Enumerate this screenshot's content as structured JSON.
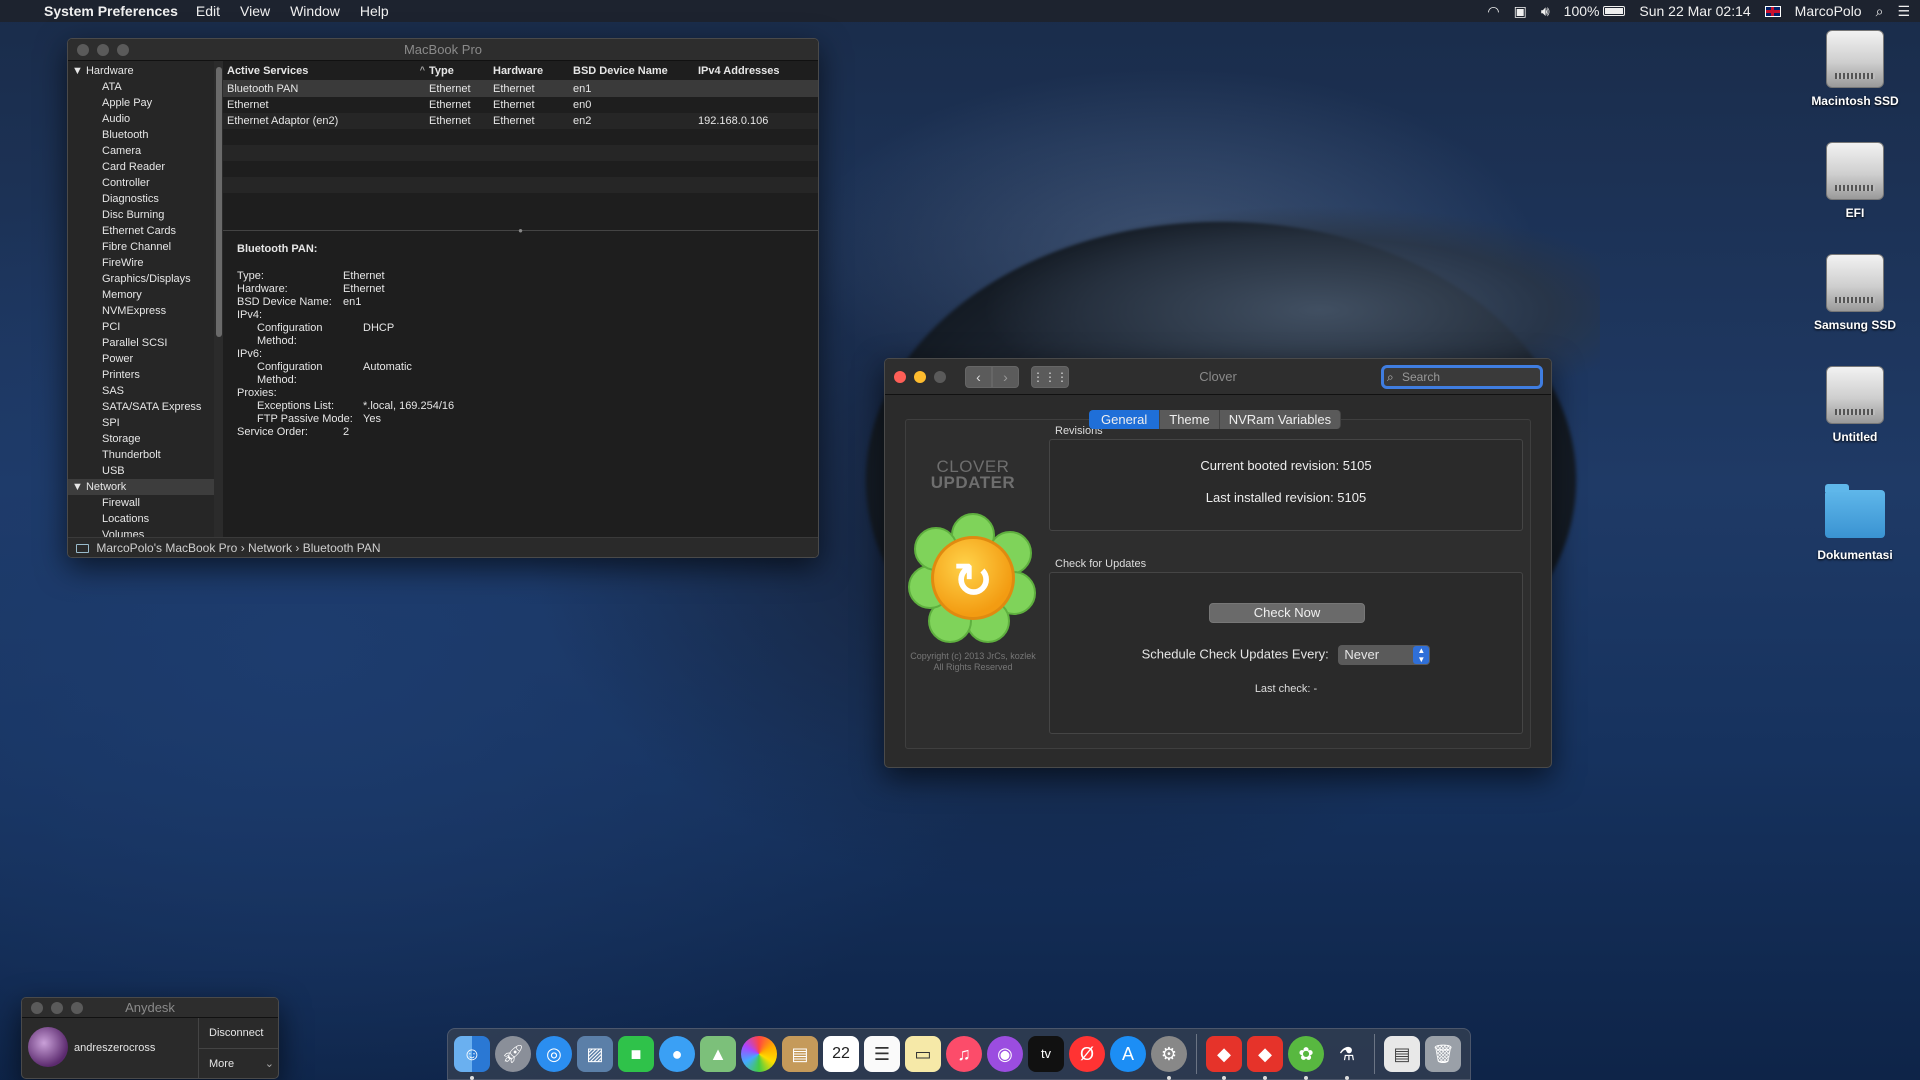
{
  "menubar": {
    "app_name": "System Preferences",
    "menus": [
      "Edit",
      "View",
      "Window",
      "Help"
    ],
    "battery": "100%",
    "datetime": "Sun 22 Mar  02:14",
    "user": "MarcoPolo"
  },
  "desktop_icons": [
    {
      "label": "Macintosh SSD",
      "icon": "drive-icon"
    },
    {
      "label": "EFI",
      "icon": "drive-icon"
    },
    {
      "label": "Samsung SSD",
      "icon": "drive-icon"
    },
    {
      "label": "Untitled",
      "icon": "drive-icon"
    },
    {
      "label": "Dokumentasi",
      "icon": "folder-icon"
    }
  ],
  "sysinfo": {
    "title": "MacBook Pro",
    "sidebar": {
      "hardware_label": "Hardware",
      "hardware_items": [
        "ATA",
        "Apple Pay",
        "Audio",
        "Bluetooth",
        "Camera",
        "Card Reader",
        "Controller",
        "Diagnostics",
        "Disc Burning",
        "Ethernet Cards",
        "Fibre Channel",
        "FireWire",
        "Graphics/Displays",
        "Memory",
        "NVMExpress",
        "PCI",
        "Parallel SCSI",
        "Power",
        "Printers",
        "SAS",
        "SATA/SATA Express",
        "SPI",
        "Storage",
        "Thunderbolt",
        "USB"
      ],
      "network_label": "Network",
      "network_items": [
        "Firewall",
        "Locations",
        "Volumes"
      ]
    },
    "table": {
      "headers": [
        "Active Services",
        "Type",
        "Hardware",
        "BSD Device Name",
        "IPv4 Addresses"
      ],
      "rows": [
        [
          "Bluetooth PAN",
          "Ethernet",
          "Ethernet",
          "en1",
          ""
        ],
        [
          "Ethernet",
          "Ethernet",
          "Ethernet",
          "en0",
          ""
        ],
        [
          "Ethernet Adaptor (en2)",
          "Ethernet",
          "Ethernet",
          "en2",
          "192.168.0.106"
        ]
      ]
    },
    "detail": {
      "heading": "Bluetooth PAN:",
      "type_k": "Type:",
      "type_v": "Ethernet",
      "hw_k": "Hardware:",
      "hw_v": "Ethernet",
      "bsd_k": "BSD Device Name:",
      "bsd_v": "en1",
      "ipv4_k": "IPv4:",
      "cm4_k": "Configuration Method:",
      "cm4_v": "DHCP",
      "ipv6_k": "IPv6:",
      "cm6_k": "Configuration Method:",
      "cm6_v": "Automatic",
      "proxies_k": "Proxies:",
      "exc_k": "Exceptions List:",
      "exc_v": "*.local, 169.254/16",
      "ftp_k": "FTP Passive Mode:",
      "ftp_v": "Yes",
      "order_k": "Service Order:",
      "order_v": "2"
    },
    "path": [
      "MarcoPolo's MacBook Pro",
      "Network",
      "Bluetooth PAN"
    ]
  },
  "clover": {
    "title": "Clover",
    "search_placeholder": "Search",
    "tabs": [
      "General",
      "Theme",
      "NVRam Variables"
    ],
    "logo_line1": "CLOVER",
    "logo_line2": "UPDATER",
    "copyright_1": "Copyright (c) 2013 JrCs, kozlek",
    "copyright_2": "All Rights Reserved",
    "revisions_label": "Revisions",
    "current_revision": "Current booted revision:  5105",
    "last_installed": "Last installed revision:  5105",
    "updates_label": "Check for Updates",
    "check_now": "Check Now",
    "schedule_label": "Schedule Check Updates Every:",
    "schedule_value": "Never",
    "last_check": "Last check: -"
  },
  "anydesk": {
    "title": "Anydesk",
    "user": "andreszerocross",
    "disconnect": "Disconnect",
    "more": "More"
  },
  "dock": {
    "date_day": "22",
    "tv_label": "tv"
  },
  "colors": {
    "accent": "#1f6fd8",
    "close": "#fe5f57",
    "minimize": "#febc2e"
  }
}
